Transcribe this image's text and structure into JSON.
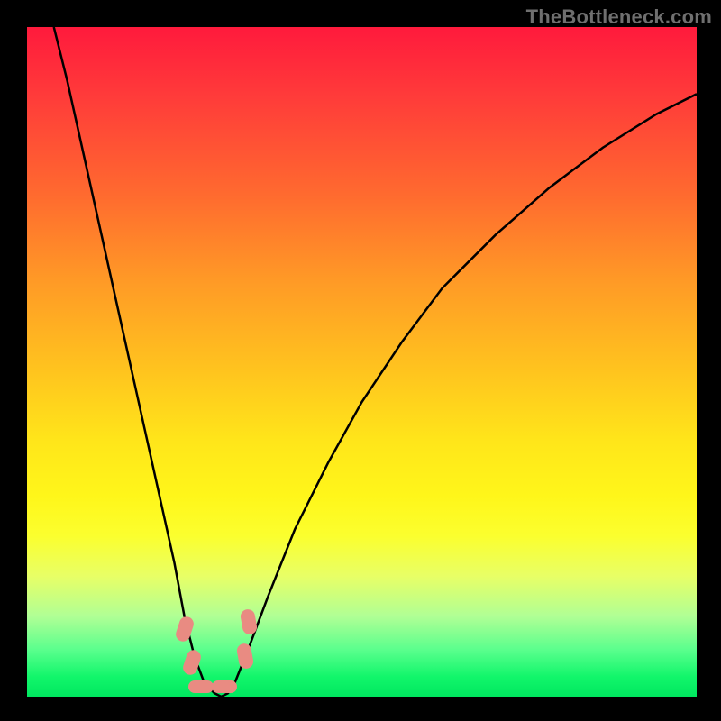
{
  "watermark": "TheBottleneck.com",
  "chart_data": {
    "type": "line",
    "title": "",
    "xlabel": "",
    "ylabel": "",
    "xlim": [
      0,
      100
    ],
    "ylim": [
      0,
      100
    ],
    "series": [
      {
        "name": "bottleneck-curve",
        "x": [
          4,
          6,
          8,
          10,
          12,
          14,
          16,
          18,
          20,
          22,
          23.5,
          25,
          26.5,
          28,
          29,
          30,
          31,
          33,
          36,
          40,
          45,
          50,
          56,
          62,
          70,
          78,
          86,
          94,
          100
        ],
        "y": [
          100,
          92,
          83,
          74,
          65,
          56,
          47,
          38,
          29,
          20,
          12,
          6,
          2,
          0.5,
          0,
          0.5,
          2,
          7,
          15,
          25,
          35,
          44,
          53,
          61,
          69,
          76,
          82,
          87,
          90
        ]
      }
    ],
    "markers": [
      {
        "name": "left-cluster-upper",
        "x": 22.5,
        "y": 12
      },
      {
        "name": "left-cluster-lower",
        "x": 23.5,
        "y": 7
      },
      {
        "name": "bottom-left",
        "x": 26.0,
        "y": 1.5
      },
      {
        "name": "bottom-right",
        "x": 29.5,
        "y": 1.5
      },
      {
        "name": "right-cluster-lower",
        "x": 31.5,
        "y": 8
      },
      {
        "name": "right-cluster-upper",
        "x": 32.0,
        "y": 13
      }
    ],
    "gradient_note": "vertical rainbow red→green"
  }
}
